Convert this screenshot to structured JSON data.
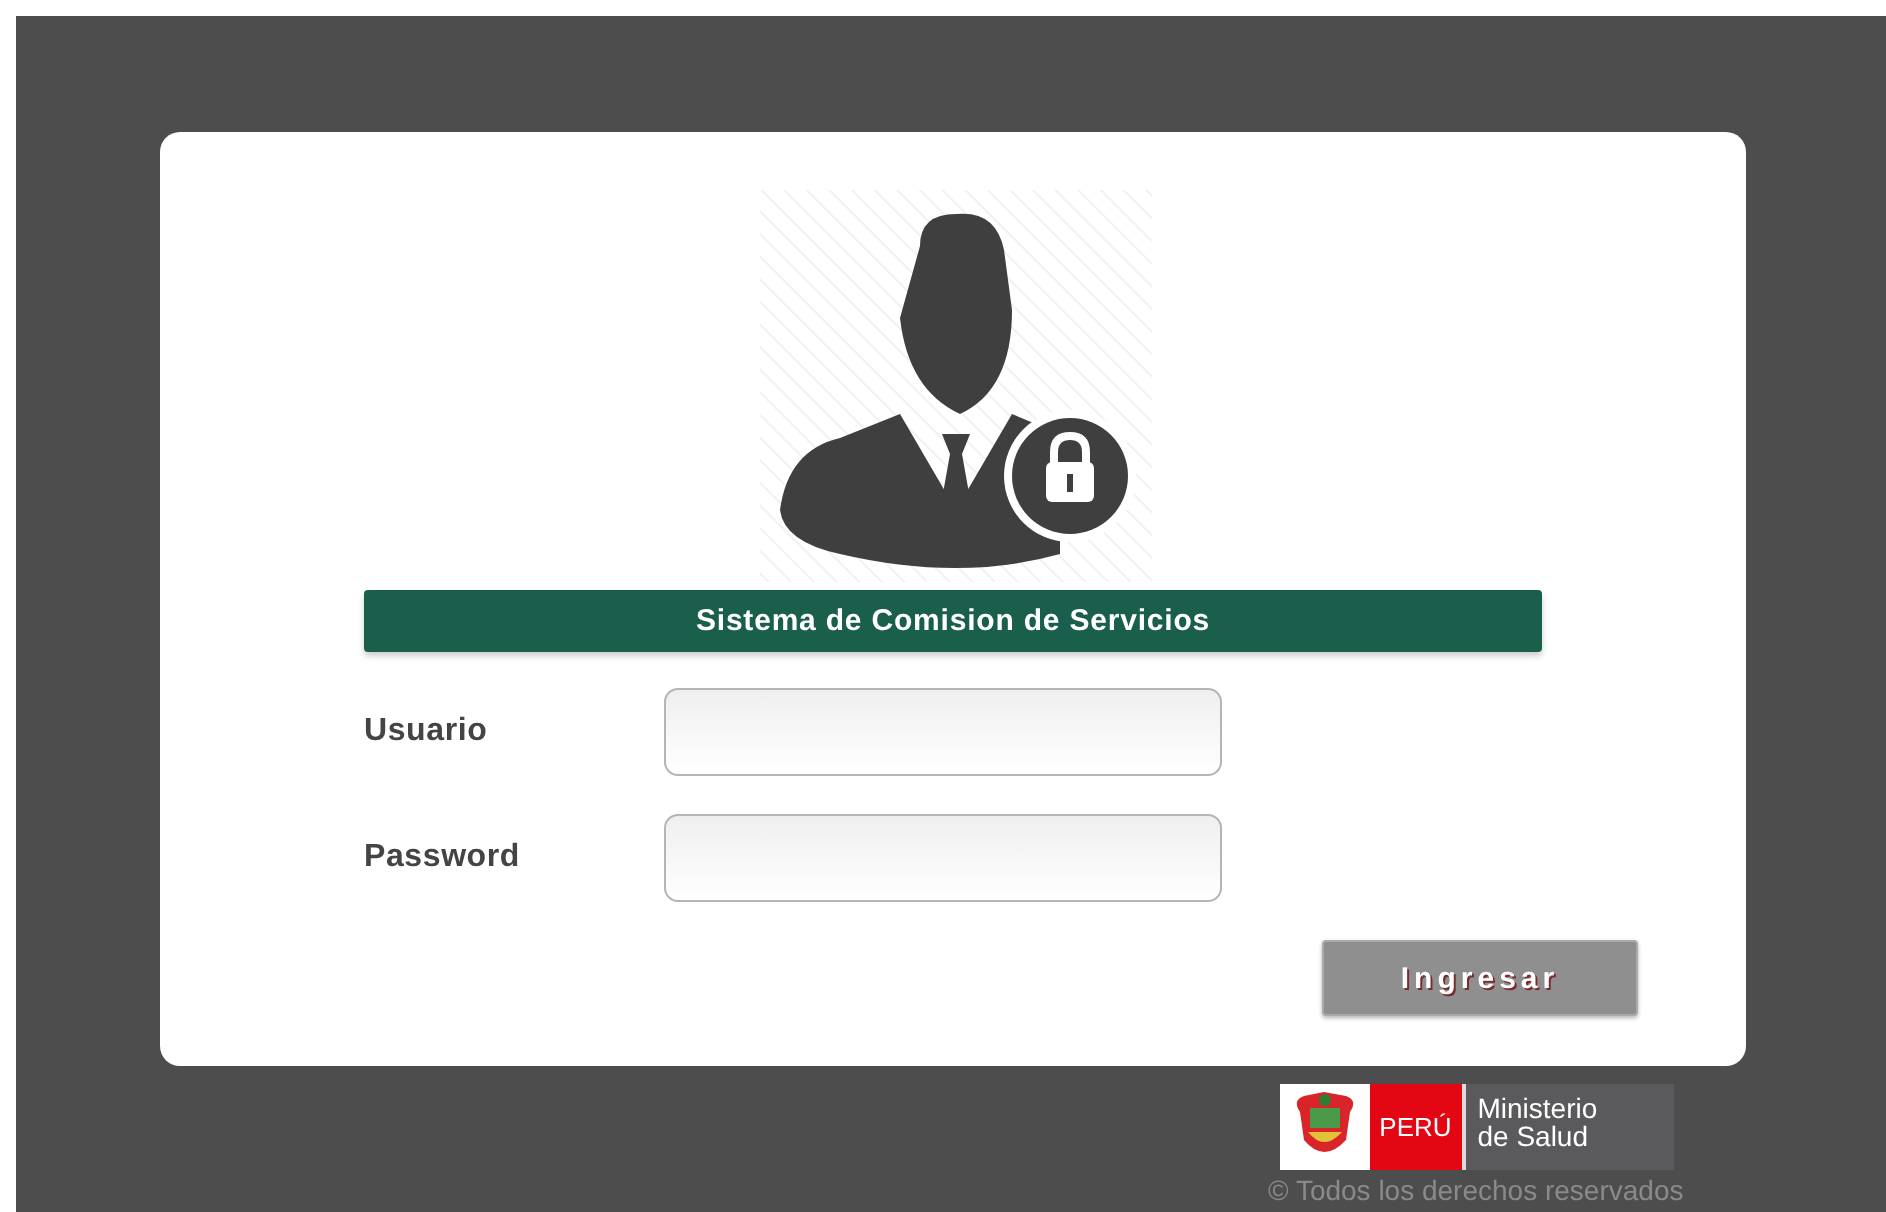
{
  "login": {
    "title": "Sistema de Comision de Servicios",
    "fields": [
      {
        "label": "Usuario"
      },
      {
        "label": "Password"
      }
    ],
    "submit": "Ingresar"
  },
  "footer": {
    "logo": {
      "country": "PERÚ",
      "ministry_line_1": "Ministerio",
      "ministry_line_2": "de Salud"
    },
    "copyright": "© Todos los derechos reservados"
  }
}
